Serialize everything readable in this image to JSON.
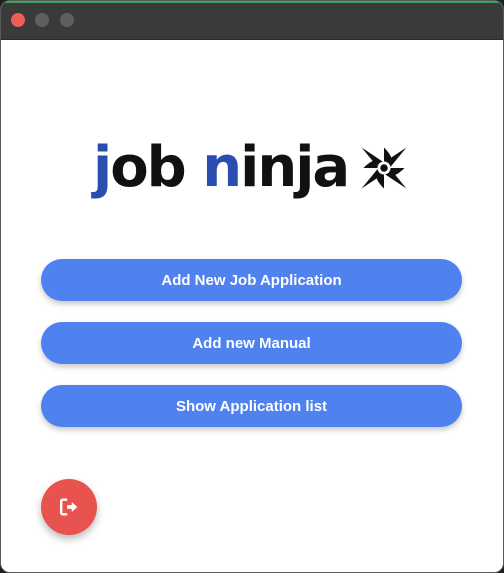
{
  "window": {
    "controls": [
      "close",
      "minimize",
      "maximize"
    ]
  },
  "logo": {
    "text_part1": "job",
    "text_part2": "ninja",
    "icon": "shuriken-icon",
    "colors": {
      "accent": "#2a4db0",
      "dark": "#111111"
    }
  },
  "actions": {
    "add_job_label": "Add New Job Application",
    "add_manual_label": "Add new Manual",
    "show_list_label": "Show Application list"
  },
  "fab": {
    "icon": "logout-icon"
  },
  "colors": {
    "button": "#4f82ee",
    "fab": "#e8534f",
    "titlebar": "#3a3a3a"
  }
}
